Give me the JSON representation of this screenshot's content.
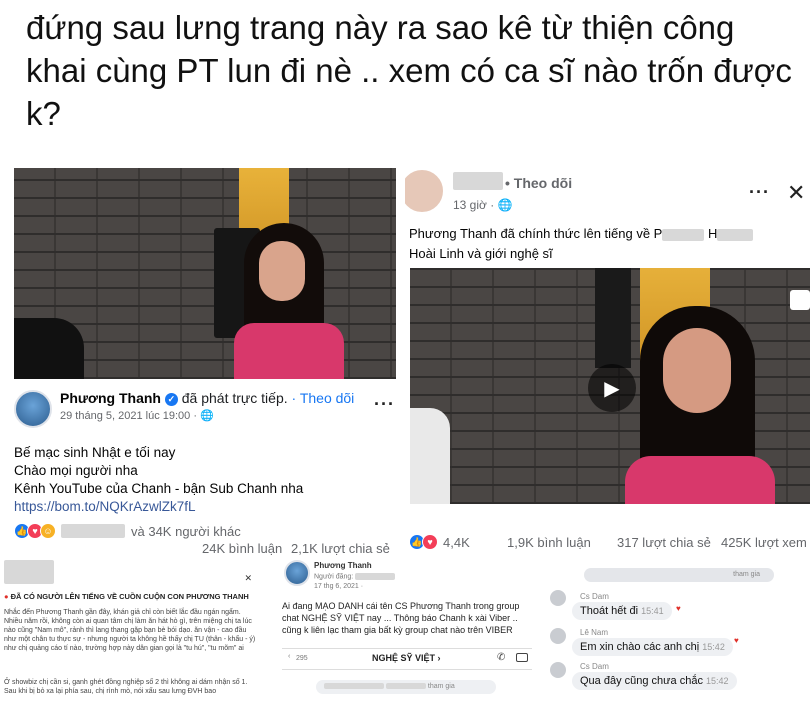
{
  "caption": "đứng sau lưng trang này ra sao kê từ thiện công khai cùng PT lun đi nè .. xem có ca sĩ nào trốn được k?",
  "left_post": {
    "author": "Phương Thanh",
    "action": "đã phát trực tiếp.",
    "follow": "· Theo dõi",
    "date": "29 tháng 5, 2021 lúc 19:00 ·",
    "line1": "Bế mạc sinh Nhật e tối nay",
    "line2": "Chào mọi người nha",
    "line3": "Kênh YouTube của Chanh - bận Sub Chanh nha",
    "link": "https://bom.to/NQKrAzwlZk7fL",
    "reactions_text": "và 34K người khác",
    "comments": "24K bình luận",
    "shares": "2,1K lượt chia sẻ",
    "more": "···"
  },
  "right_post": {
    "follow": "• Theo dõi",
    "time": "13 giờ ·",
    "globe_icon": "globe-icon",
    "text1": "Phương Thanh đã chính thức lên tiếng về P",
    "text1b": "H",
    "text2": "Hoài Linh và giới nghệ sĩ",
    "reactions": "4,4K",
    "comments": "1,9K bình luận",
    "shares": "317 lượt chia sẻ",
    "views": "425K lượt xem",
    "more": "···",
    "close": "✕"
  },
  "bottom_left": {
    "title": "ĐÃ CÓ NGƯỜI LÊN TIẾNG VỀ CUỒN CUỘN CON PHƯƠNG THANH",
    "para1": "Nhắc đến Phương Thanh gần đây, khán giả chỉ còn biết lắc đầu ngán ngẩm. Nhiều năm rồi, không còn ai quan tâm chị làm ăn hát hò gì, trên miệng chị ta lúc nào cũng \"Nam mô\", rảnh thì lang thang gặp bạn bè bói dạo. ăn vận - cao đầu như một chân tu thực sự - nhưng người ta không hề thấy chị TU (thân - khẩu - ý) như chị quảng cáo tí nào, trường hợp này dân gian gọi là \"tu hú\", \"tu mõm\" ai",
    "para2": "Ở showbiz chị cần si, ganh ghét đồng nghiệp số 2 thì không ai dám nhận số 1. Sau khi bị bỏ xa lại phía sau, chị rình mò, nói xấu sau lưng ĐVH bao"
  },
  "bottom_mid": {
    "name": "Phương Thanh",
    "role": "Người đăng:",
    "date": "17 thg 6, 2021 ·",
    "text1": "Ai đang MẠO DANH cái tên CS Phương Thanh trong group chat NGHỆ SỸ VIỆT nay ... Thông báo Chanh k xài Viber ..",
    "text2": "cũng k liên lạc tham gia bất kỳ group chat nào trên VIBER",
    "group": "NGHỆ SỸ VIỆT ›",
    "count": "295",
    "joined": "tham gia"
  },
  "bottom_right": {
    "badge": "tham gia",
    "msgs": [
      {
        "name": "Cs Dam",
        "text": "Thoát hết đi",
        "time": "15:41"
      },
      {
        "name": "Lê Nam",
        "text": "Em xin chào các anh chị",
        "time": "15:42"
      },
      {
        "name": "Cs Dam",
        "text": "Qua đây cũng chưa chắc",
        "time": "15:42"
      }
    ]
  }
}
